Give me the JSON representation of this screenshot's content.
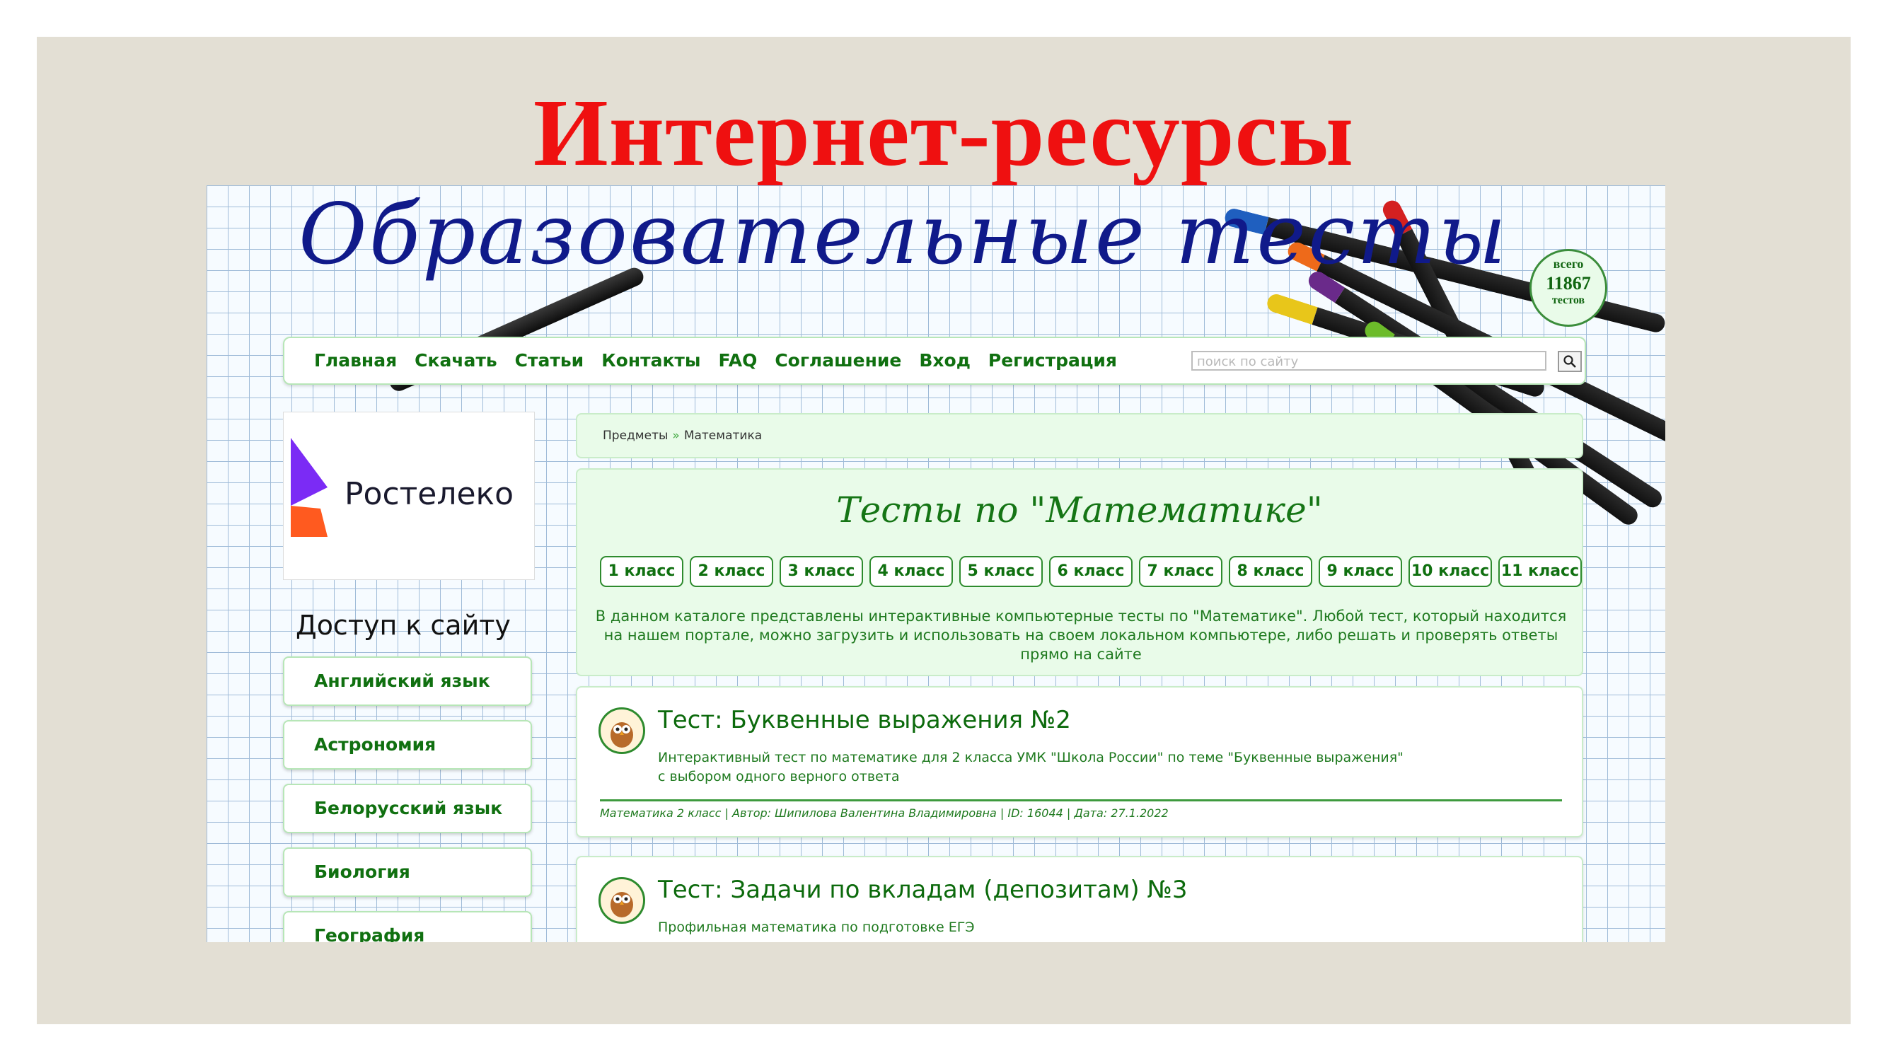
{
  "slide": {
    "title": "Интернет-ресурсы"
  },
  "site": {
    "logo_text": "Образовательные тесты",
    "counter": {
      "top": "всего",
      "value": "11867",
      "bottom": "тестов"
    }
  },
  "nav": {
    "items": [
      "Главная",
      "Скачать",
      "Статьи",
      "Контакты",
      "FAQ",
      "Соглашение",
      "Вход",
      "Регистрация"
    ],
    "search_placeholder": "поиск по сайту"
  },
  "sidebar": {
    "ad_name": "Ростелеко",
    "access_text": "Доступ к сайту",
    "subjects": [
      "Английский язык",
      "Астрономия",
      "Белорусский язык",
      "Биология",
      "География"
    ]
  },
  "breadcrumb": {
    "items": [
      "Предметы",
      "Математика"
    ],
    "separator": "»"
  },
  "tests_panel": {
    "title": "Тесты по \"Математике\"",
    "grades": [
      "1 класс",
      "2 класс",
      "3 класс",
      "4 класс",
      "5 класс",
      "6 класс",
      "7 класс",
      "8 класс",
      "9 класс",
      "10 класс",
      "11 класс"
    ],
    "description": "В данном каталоге представлены интерактивные компьютерные тесты по \"Математике\". Любой тест, который находится на нашем портале, можно загрузить и использовать на своем локальном компьютере, либо решать и проверять ответы прямо на сайте"
  },
  "tests": [
    {
      "title": "Тест: Буквенные выражения №2",
      "description_lines": [
        "Интерактивный тест по математике для 2 класса УМК \"Школа России\" по теме \"Буквенные выражения\"",
        "с выбором одного верного ответа"
      ],
      "meta": "Математика 2 класс | Автор: Шипилова Валентина Владимировна | ID: 16044 | Дата: 27.1.2022"
    },
    {
      "title": "Тест: Задачи по вкладам (депозитам) №3",
      "description_lines": [
        "Профильная математика по подготовке ЕГЭ"
      ],
      "meta": ""
    }
  ],
  "colors": {
    "slide_bg": "#e3dfd4",
    "title_red": "#ef1010",
    "site_green": "#107010",
    "panel_green": "#e9fbe9",
    "logo_blue": "#101a8a"
  }
}
